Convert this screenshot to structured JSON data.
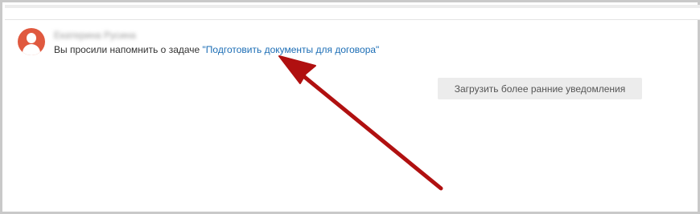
{
  "notification": {
    "sender_name": "Екатерина Русина",
    "message_prefix": "Вы просили напомнить о задаче ",
    "task_link": "\"Подготовить документы для договора\""
  },
  "load_more": {
    "label": "Загрузить более ранние уведомления"
  },
  "colors": {
    "avatar": "#e0593f",
    "link": "#1b6db5",
    "arrow": "#b01010",
    "button_bg": "#ececec"
  },
  "icons": {
    "avatar": "user-avatar-icon",
    "annotation": "red-arrow-annotation"
  }
}
